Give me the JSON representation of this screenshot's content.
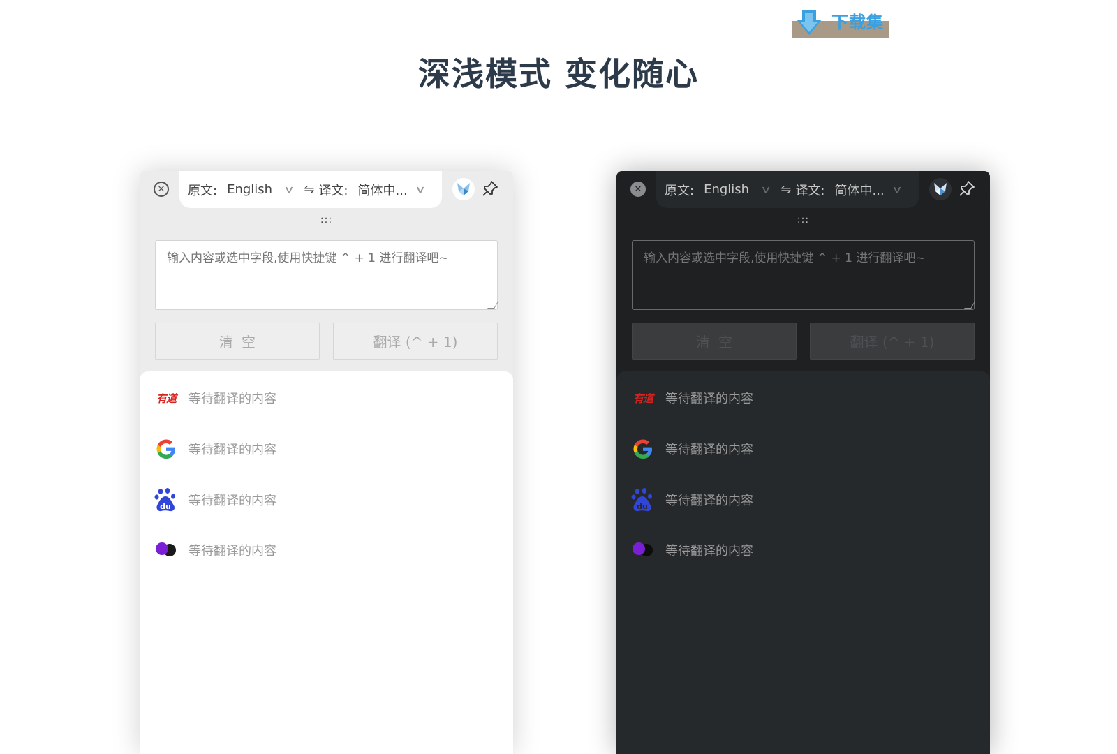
{
  "watermark": {
    "text": "下载集"
  },
  "headline": "深浅模式 变化随心",
  "windows": [
    {
      "theme": "light",
      "source_label": "原文:",
      "source_lang": "English",
      "swap_symbol": "⇋",
      "target_label": "译文:",
      "target_lang": "简体中...",
      "drag_handle": ":::",
      "input_placeholder": "输入内容或选中字段,使用快捷键 ^ + 1 进行翻译吧~",
      "clear_label": "清空",
      "translate_label": "翻译 (^ + 1)",
      "results": [
        {
          "engine": "youdao-icon",
          "brand_text": "有道",
          "text": "等待翻译的内容"
        },
        {
          "engine": "google-icon",
          "text": "等待翻译的内容"
        },
        {
          "engine": "baidu-icon",
          "text": "等待翻译的内容"
        },
        {
          "engine": "caiyun-icon",
          "text": "等待翻译的内容"
        }
      ]
    },
    {
      "theme": "dark",
      "source_label": "原文:",
      "source_lang": "English",
      "swap_symbol": "⇋",
      "target_label": "译文:",
      "target_lang": "简体中...",
      "drag_handle": ":::",
      "input_placeholder": "输入内容或选中字段,使用快捷键 ^ + 1 进行翻译吧~",
      "clear_label": "清空",
      "translate_label": "翻译 (^ + 1)",
      "results": [
        {
          "engine": "youdao-icon",
          "brand_text": "有道",
          "text": "等待翻译的内容"
        },
        {
          "engine": "google-icon",
          "text": "等待翻译的内容"
        },
        {
          "engine": "baidu-icon",
          "text": "等待翻译的内容"
        },
        {
          "engine": "caiyun-icon",
          "text": "等待翻译的内容"
        }
      ]
    }
  ],
  "colors": {
    "headline": "#2c3a4a",
    "light_bg": "#ececec",
    "dark_bg": "#1e2022",
    "youdao_red": "#d8231f",
    "baidu_blue": "#3145d9",
    "caiyun_purple": "#7b1fd6"
  }
}
